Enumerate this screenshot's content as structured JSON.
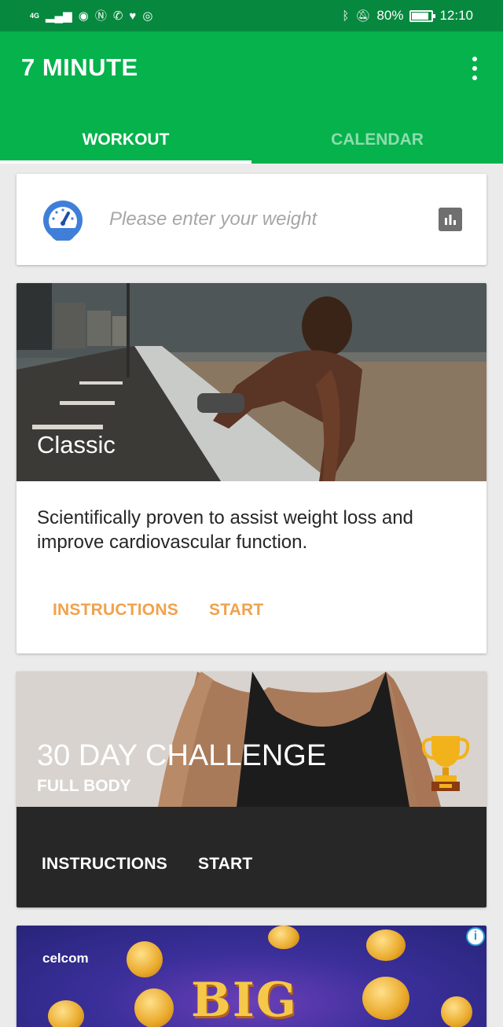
{
  "status_bar": {
    "network": "4G",
    "battery": "80%",
    "time": "12:10"
  },
  "app_bar": {
    "title": "7 MINUTE",
    "tabs": [
      {
        "label": "WORKOUT",
        "selected": true
      },
      {
        "label": "CALENDAR",
        "selected": false
      }
    ]
  },
  "weight_card": {
    "placeholder": "Please enter your weight",
    "icon": "gauge-icon",
    "action_icon": "bar-chart-icon"
  },
  "classic_card": {
    "title": "Classic",
    "description": "Scientifically proven to assist weight loss and improve cardiovascular function.",
    "instructions_label": "INSTRUCTIONS",
    "start_label": "START"
  },
  "challenge_card": {
    "title": "30 DAY CHALLENGE",
    "subtitle": "FULL BODY",
    "instructions_label": "INSTRUCTIONS",
    "start_label": "START",
    "badge_icon": "trophy-icon"
  },
  "ad": {
    "brand": "celcom",
    "headline": "BIG",
    "info_icon": "info-icon"
  },
  "colors": {
    "status_bar": "#07883f",
    "app_bar": "#05b24c",
    "accent_orange": "#f0a24c",
    "gauge_blue": "#3f7fd8",
    "dark_card": "#272727"
  }
}
